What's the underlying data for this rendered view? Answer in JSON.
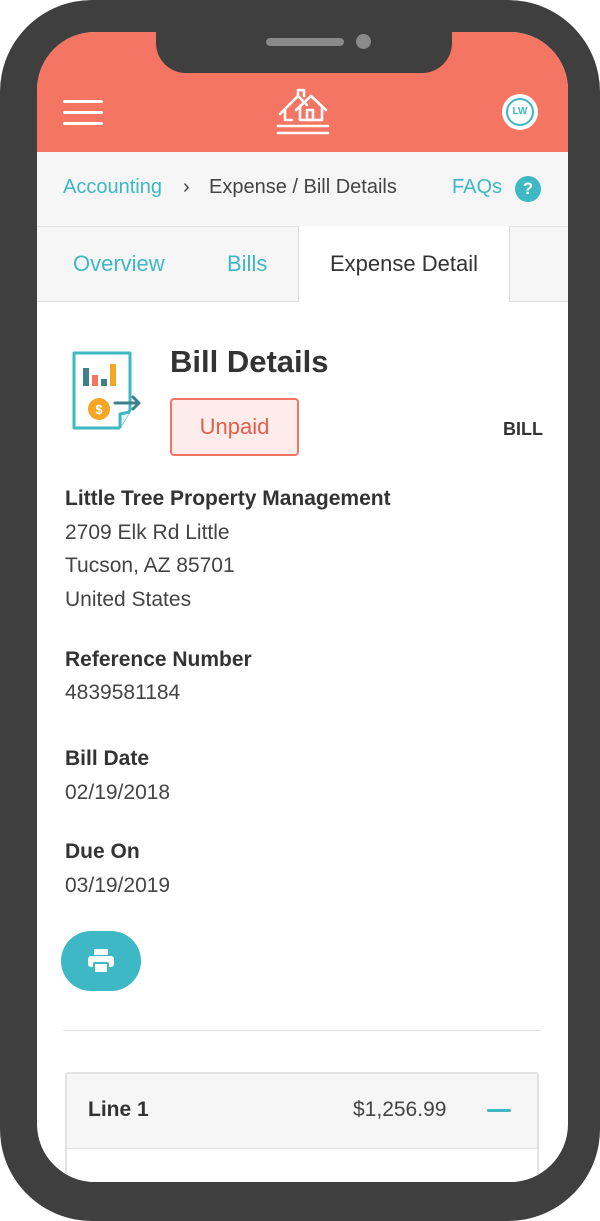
{
  "header": {
    "menu_icon": "hamburger-menu-icon",
    "logo_icon": "house-logo-icon",
    "avatar_initials": "LW"
  },
  "breadcrumb": {
    "parent": "Accounting",
    "separator": "›",
    "current": "Expense / Bill Details",
    "faq": "FAQs",
    "help_glyph": "?"
  },
  "tabs": [
    {
      "label": "Overview"
    },
    {
      "label": "Bills"
    },
    {
      "label": "Expense Detail",
      "active": true
    }
  ],
  "bill": {
    "title": "Bill Details",
    "status": "Unpaid",
    "type": "BILL",
    "vendor": "Little Tree Property Management",
    "address_lines": [
      "2709 Elk Rd Little",
      "Tucson, AZ 85701",
      "United States"
    ],
    "fields": [
      {
        "label": "Reference Number",
        "value": "4839581184"
      },
      {
        "label": "Bill Date",
        "value": "02/19/2018"
      },
      {
        "label": "Due On",
        "value": "03/19/2019"
      }
    ]
  },
  "actions": {
    "print_icon": "printer-icon"
  },
  "line_items": [
    {
      "label": "Line 1",
      "amount": "$1,256.99"
    }
  ],
  "colors": {
    "brand_coral": "#f47562",
    "accent_teal": "#3db8c4",
    "status_red": "#e05f4c",
    "phone_frame": "#3f3f3f"
  }
}
